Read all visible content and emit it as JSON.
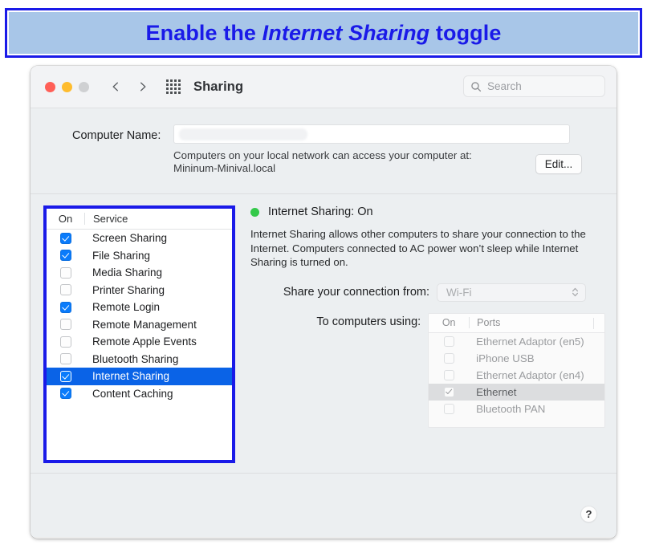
{
  "banner": {
    "text_before": "Enable the ",
    "text_emphasis": "Internet Sharing",
    "text_after": " toggle",
    "border_color": "#1a1ae8",
    "fill_color": "#a8c6e8",
    "text_color": "#1a1ae8"
  },
  "window": {
    "title": "Sharing",
    "traffic_lights": [
      "close",
      "minimize",
      "zoom"
    ],
    "back_icon": "chevron-left-icon",
    "forward_icon": "chevron-right-icon",
    "grid_icon": "grid-view-icon",
    "search": {
      "placeholder": "Search",
      "value": "",
      "icon": "search-icon"
    }
  },
  "computer_name": {
    "label": "Computer Name:",
    "value": "",
    "note_line1": "Computers on your local network can access your computer at:",
    "note_line2": "Mininum-Minival.local",
    "edit_label": "Edit..."
  },
  "services": {
    "columns": [
      "On",
      "Service"
    ],
    "rows": [
      {
        "label": "Screen Sharing",
        "checked": true,
        "selected": false
      },
      {
        "label": "File Sharing",
        "checked": true,
        "selected": false
      },
      {
        "label": "Media Sharing",
        "checked": false,
        "selected": false
      },
      {
        "label": "Printer Sharing",
        "checked": false,
        "selected": false
      },
      {
        "label": "Remote Login",
        "checked": true,
        "selected": false
      },
      {
        "label": "Remote Management",
        "checked": false,
        "selected": false
      },
      {
        "label": "Remote Apple Events",
        "checked": false,
        "selected": false
      },
      {
        "label": "Bluetooth Sharing",
        "checked": false,
        "selected": false
      },
      {
        "label": "Internet Sharing",
        "checked": true,
        "selected": true
      },
      {
        "label": "Content Caching",
        "checked": true,
        "selected": false
      }
    ],
    "highlight_color": "#1a1ae8",
    "selected_row_color": "#0a63e7",
    "checkbox_color": "#0a7bfb"
  },
  "detail": {
    "status_title": "Internet Sharing: On",
    "status_dot_color": "#34c94a",
    "description": "Internet Sharing allows other computers to share your connection to the Internet. Computers connected to AC power won’t sleep while Internet Sharing is turned on.",
    "share_from": {
      "label": "Share your connection from:",
      "value": "Wi-Fi",
      "disabled": true,
      "icon": "stepper-updown-icon"
    },
    "ports": {
      "label": "To computers using:",
      "columns": [
        "On",
        "Ports"
      ],
      "rows": [
        {
          "label": "Ethernet Adaptor (en5)",
          "checked": false,
          "selected": false
        },
        {
          "label": "iPhone USB",
          "checked": false,
          "selected": false
        },
        {
          "label": "Ethernet Adaptor (en4)",
          "checked": false,
          "selected": false
        },
        {
          "label": "Ethernet",
          "checked": true,
          "selected": true
        },
        {
          "label": "Bluetooth PAN",
          "checked": false,
          "selected": false
        }
      ],
      "disabled": true
    }
  },
  "footer": {
    "help_label": "?"
  }
}
